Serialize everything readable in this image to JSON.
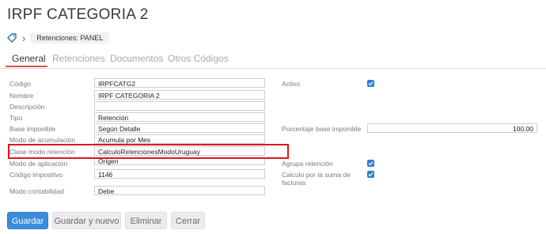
{
  "page_title": "IRPF CATEGORIA 2",
  "breadcrumb": {
    "panel": "Retenciones: PANEL"
  },
  "tabs": [
    "General",
    "Retenciones",
    "Documentos",
    "Otros Códigos"
  ],
  "form": {
    "codigo": {
      "label": "Código",
      "value": "IRPFCATG2"
    },
    "nombre": {
      "label": "Nombre",
      "value": "IRPF CATEGORIA 2"
    },
    "descripcion": {
      "label": "Descripción",
      "value": ""
    },
    "tipo": {
      "label": "Tipo",
      "value": "Retención"
    },
    "base_imponible": {
      "label": "Base imponible",
      "value": "Según Detalle"
    },
    "modo_acumulacion": {
      "label": "Modo de acumulación",
      "value": "Acumula por Mes"
    },
    "clase_modo_retencion": {
      "label": "Clase modo retención",
      "value": "CalculoRetencionesModoUruguay"
    },
    "modo_aplicacion": {
      "label": "Modo de aplicación",
      "value": "Origen"
    },
    "codigo_impositivo": {
      "label": "Código impositivo",
      "value": "1146"
    },
    "modo_contabilidad": {
      "label": "Modo contabilidad",
      "value": "Debe"
    },
    "activo": {
      "label": "Activo",
      "checked": true
    },
    "porcentaje_base": {
      "label": "Porcentaje base imponible",
      "value": "100.00"
    },
    "agrupa_retencion": {
      "label": "Agrupa retención",
      "checked": true
    },
    "calculo_suma": {
      "label": "Calculo por la suma de facturas",
      "checked": true
    }
  },
  "buttons": {
    "save": "Guardar",
    "save_new": "Guardar y nuevo",
    "delete": "Eliminar",
    "close": "Cerrar"
  },
  "colors": {
    "primary": "#3a8ddb",
    "highlight": "#e0141e",
    "tab_active_underline": "#d9534f"
  }
}
